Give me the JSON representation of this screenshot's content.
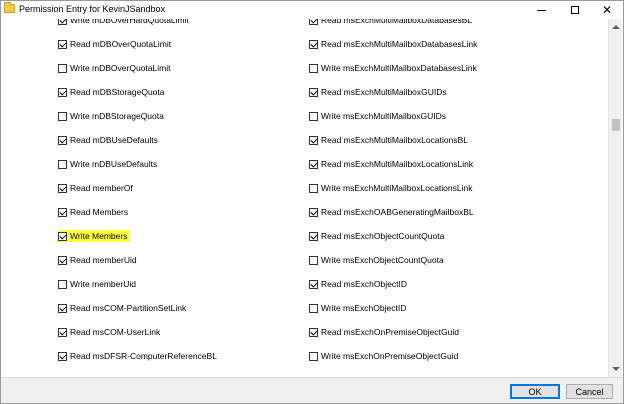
{
  "window": {
    "title": "Permission Entry for KevinJSandbox"
  },
  "permissions_left": [
    {
      "label": "Write mDBOverHardQuotaLimit",
      "checked": true
    },
    {
      "label": "Read mDBOverQuotaLimit",
      "checked": true
    },
    {
      "label": "Write mDBOverQuotaLimit",
      "checked": false
    },
    {
      "label": "Read mDBStorageQuota",
      "checked": true
    },
    {
      "label": "Write mDBStorageQuota",
      "checked": false
    },
    {
      "label": "Read mDBUseDefaults",
      "checked": true
    },
    {
      "label": "Write mDBUseDefaults",
      "checked": false
    },
    {
      "label": "Read memberOf",
      "checked": true
    },
    {
      "label": "Read Members",
      "checked": true
    },
    {
      "label": "Write Members",
      "checked": true,
      "highlighted": true
    },
    {
      "label": "Read memberUid",
      "checked": true
    },
    {
      "label": "Write memberUid",
      "checked": false
    },
    {
      "label": "Read msCOM-PartitionSetLink",
      "checked": true
    },
    {
      "label": "Read msCOM-UserLink",
      "checked": true
    },
    {
      "label": "Read msDFSR-ComputerReferenceBL",
      "checked": true
    }
  ],
  "permissions_right": [
    {
      "label": "Read msExchMultiMailboxDatabasesBL",
      "checked": true
    },
    {
      "label": "Read msExchMultiMailboxDatabasesLink",
      "checked": true
    },
    {
      "label": "Write msExchMultiMailboxDatabasesLink",
      "checked": false
    },
    {
      "label": "Read msExchMultiMailboxGUIDs",
      "checked": true
    },
    {
      "label": "Write msExchMultiMailboxGUIDs",
      "checked": false
    },
    {
      "label": "Read msExchMultiMailboxLocationsBL",
      "checked": true
    },
    {
      "label": "Read msExchMultiMailboxLocationsLink",
      "checked": true
    },
    {
      "label": "Write msExchMultiMailboxLocationsLink",
      "checked": false
    },
    {
      "label": "Read msExchOABGeneratingMailboxBL",
      "checked": true
    },
    {
      "label": "Read msExchObjectCountQuota",
      "checked": true
    },
    {
      "label": "Write msExchObjectCountQuota",
      "checked": false
    },
    {
      "label": "Read msExchObjectID",
      "checked": true
    },
    {
      "label": "Write msExchObjectID",
      "checked": false
    },
    {
      "label": "Read msExchOnPremiseObjectGuid",
      "checked": true
    },
    {
      "label": "Write msExchOnPremiseObjectGuid",
      "checked": false
    }
  ],
  "footer": {
    "ok_label": "OK",
    "cancel_label": "Cancel"
  },
  "icons": {
    "title": "folder-icon",
    "minimize": "minimize-icon",
    "maximize": "maximize-icon",
    "close": "close-icon",
    "checkbox": "checkmark-icon"
  },
  "colors": {
    "highlight": "#ffff3c",
    "ok_border": "#0078d7"
  }
}
